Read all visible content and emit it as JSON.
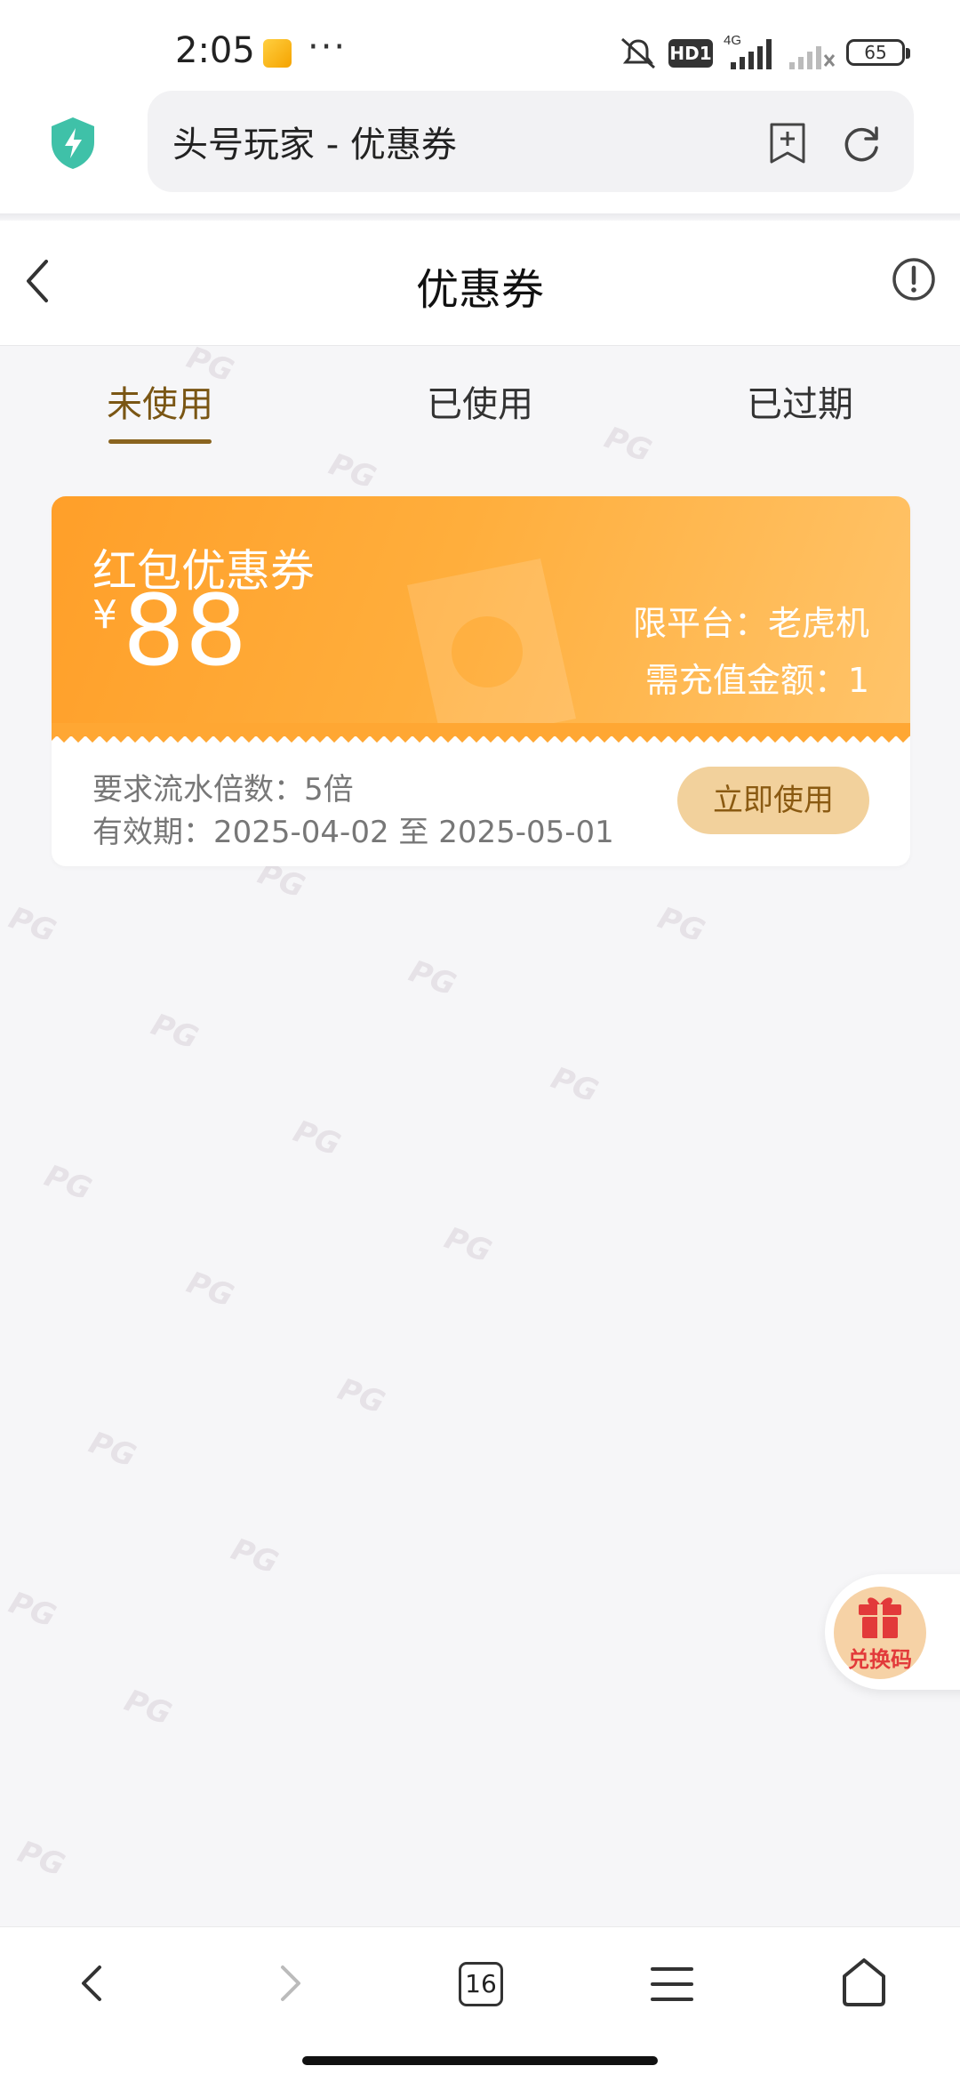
{
  "status_bar": {
    "time": "2:05",
    "dots": "···",
    "hd_badge": "HD1",
    "network": "4G",
    "battery": "65"
  },
  "browser": {
    "url_title": "头号玩家 - 优惠券"
  },
  "header": {
    "title": "优惠券"
  },
  "tabs": [
    {
      "label": "未使用",
      "active": true
    },
    {
      "label": "已使用",
      "active": false
    },
    {
      "label": "已过期",
      "active": false
    }
  ],
  "coupon": {
    "type": "红包优惠券",
    "currency": "¥",
    "amount": "88",
    "platform": "限平台：老虎机",
    "recharge": "需充值金额：1",
    "turnover": "要求流水倍数：5倍",
    "validity": "有效期：2025-04-02 至 2025-05-01",
    "button": "立即使用"
  },
  "redeem": {
    "label": "兑换码"
  },
  "bottom_nav": {
    "tabs_count": "16"
  },
  "watermark": "PG",
  "colors": {
    "accent": "#8a6420",
    "coupon_orange": "#ffa12e",
    "button_bg": "#f2d19c"
  }
}
